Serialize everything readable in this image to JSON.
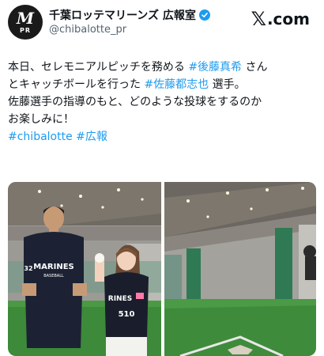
{
  "account": {
    "avatar_letter": "M",
    "avatar_sub": "PR",
    "display_name": "千葉ロッテマリーンズ 広報室",
    "handle": "@chibalotte_pr",
    "verified": true
  },
  "brand": {
    "x_letter": "𝕏",
    "suffix": ".com"
  },
  "tweet": {
    "line1_text": "本日、セレモニアルピッチを務める ",
    "line1_tag": "#後藤真希",
    "line1_tail": " さん",
    "line2_text": "とキャッチボールを行った ",
    "line2_tag": "#佐藤都志也",
    "line2_tail": " 選手。",
    "line3": "佐藤選手の指導のもと、どのような投球をするのか",
    "line4": "お楽しみに！",
    "hashtag1": "#chibalotte",
    "hashtag2": "#広報"
  },
  "photo_left": {
    "player_jersey_text": "MARINES",
    "player_jersey_sub": "BASEBALL",
    "player_sleeve_number": "32",
    "girl_jersey_text": "RINES",
    "girl_number": "510"
  },
  "colors": {
    "accent": "#1d9bf0",
    "text": "#0f1419",
    "muted": "#536471",
    "turf": "#3d8a3a"
  },
  "icons": [
    "verified-badge-icon",
    "x-logo-icon"
  ]
}
